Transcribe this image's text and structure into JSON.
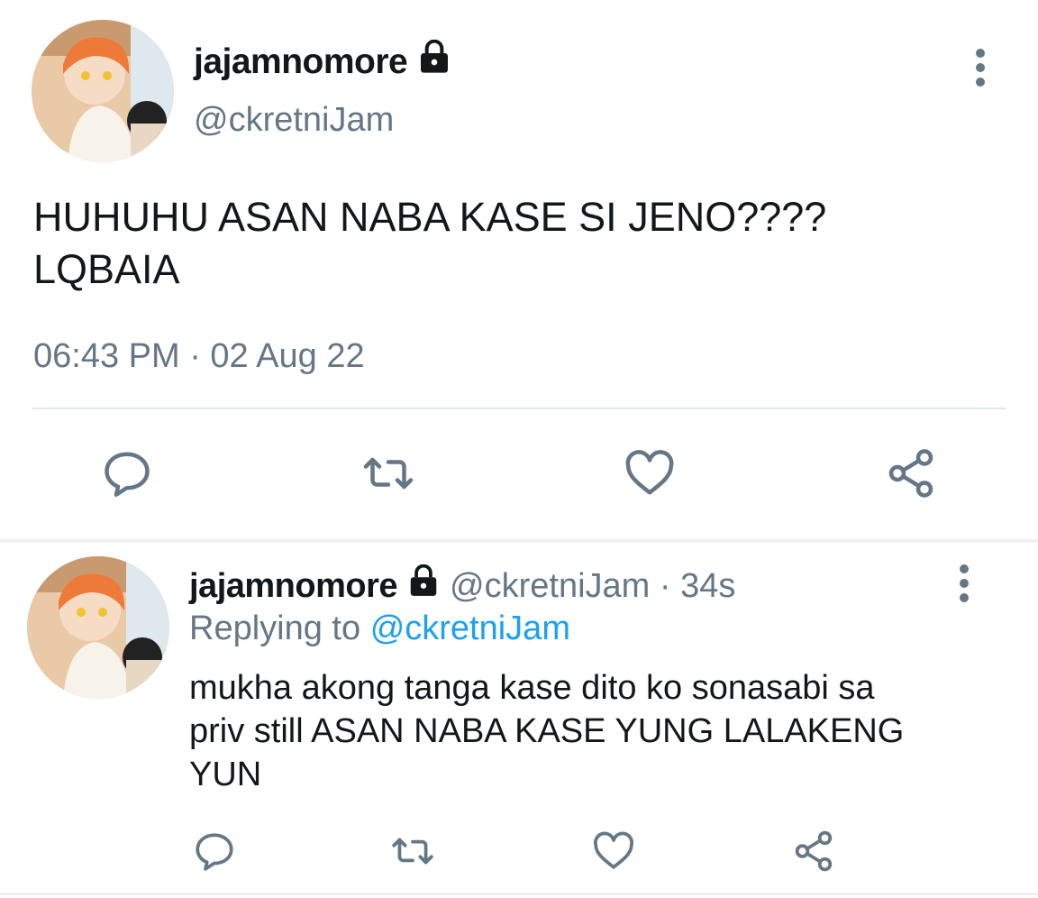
{
  "main_tweet": {
    "display_name": "jajamnomore",
    "handle": "@ckretniJam",
    "text_line1": "HUHUHU ASAN NABA KASE SI JENO????",
    "text_line2": "LQBAIA",
    "timestamp": "06:43 PM · 02 Aug 22",
    "actions": [
      "reply-icon",
      "retweet-icon",
      "like-icon",
      "share-icon"
    ]
  },
  "reply_tweet": {
    "display_name": "jajamnomore",
    "handle_time": "@ckretniJam · 34s",
    "replying_prefix": "Replying to",
    "replying_handle": "@ckretniJam",
    "text_line1": "mukha akong tanga kase dito ko sonasabi sa",
    "text_line2": "priv still ASAN NABA KASE YUNG LALAKENG",
    "text_line3": "YUN",
    "actions": [
      "reply-icon",
      "retweet-icon",
      "like-icon",
      "share-icon"
    ]
  },
  "colors": {
    "text": "#14171a",
    "secondary": "#657786",
    "link": "#1da1f2",
    "divider": "#e1e8ed"
  }
}
